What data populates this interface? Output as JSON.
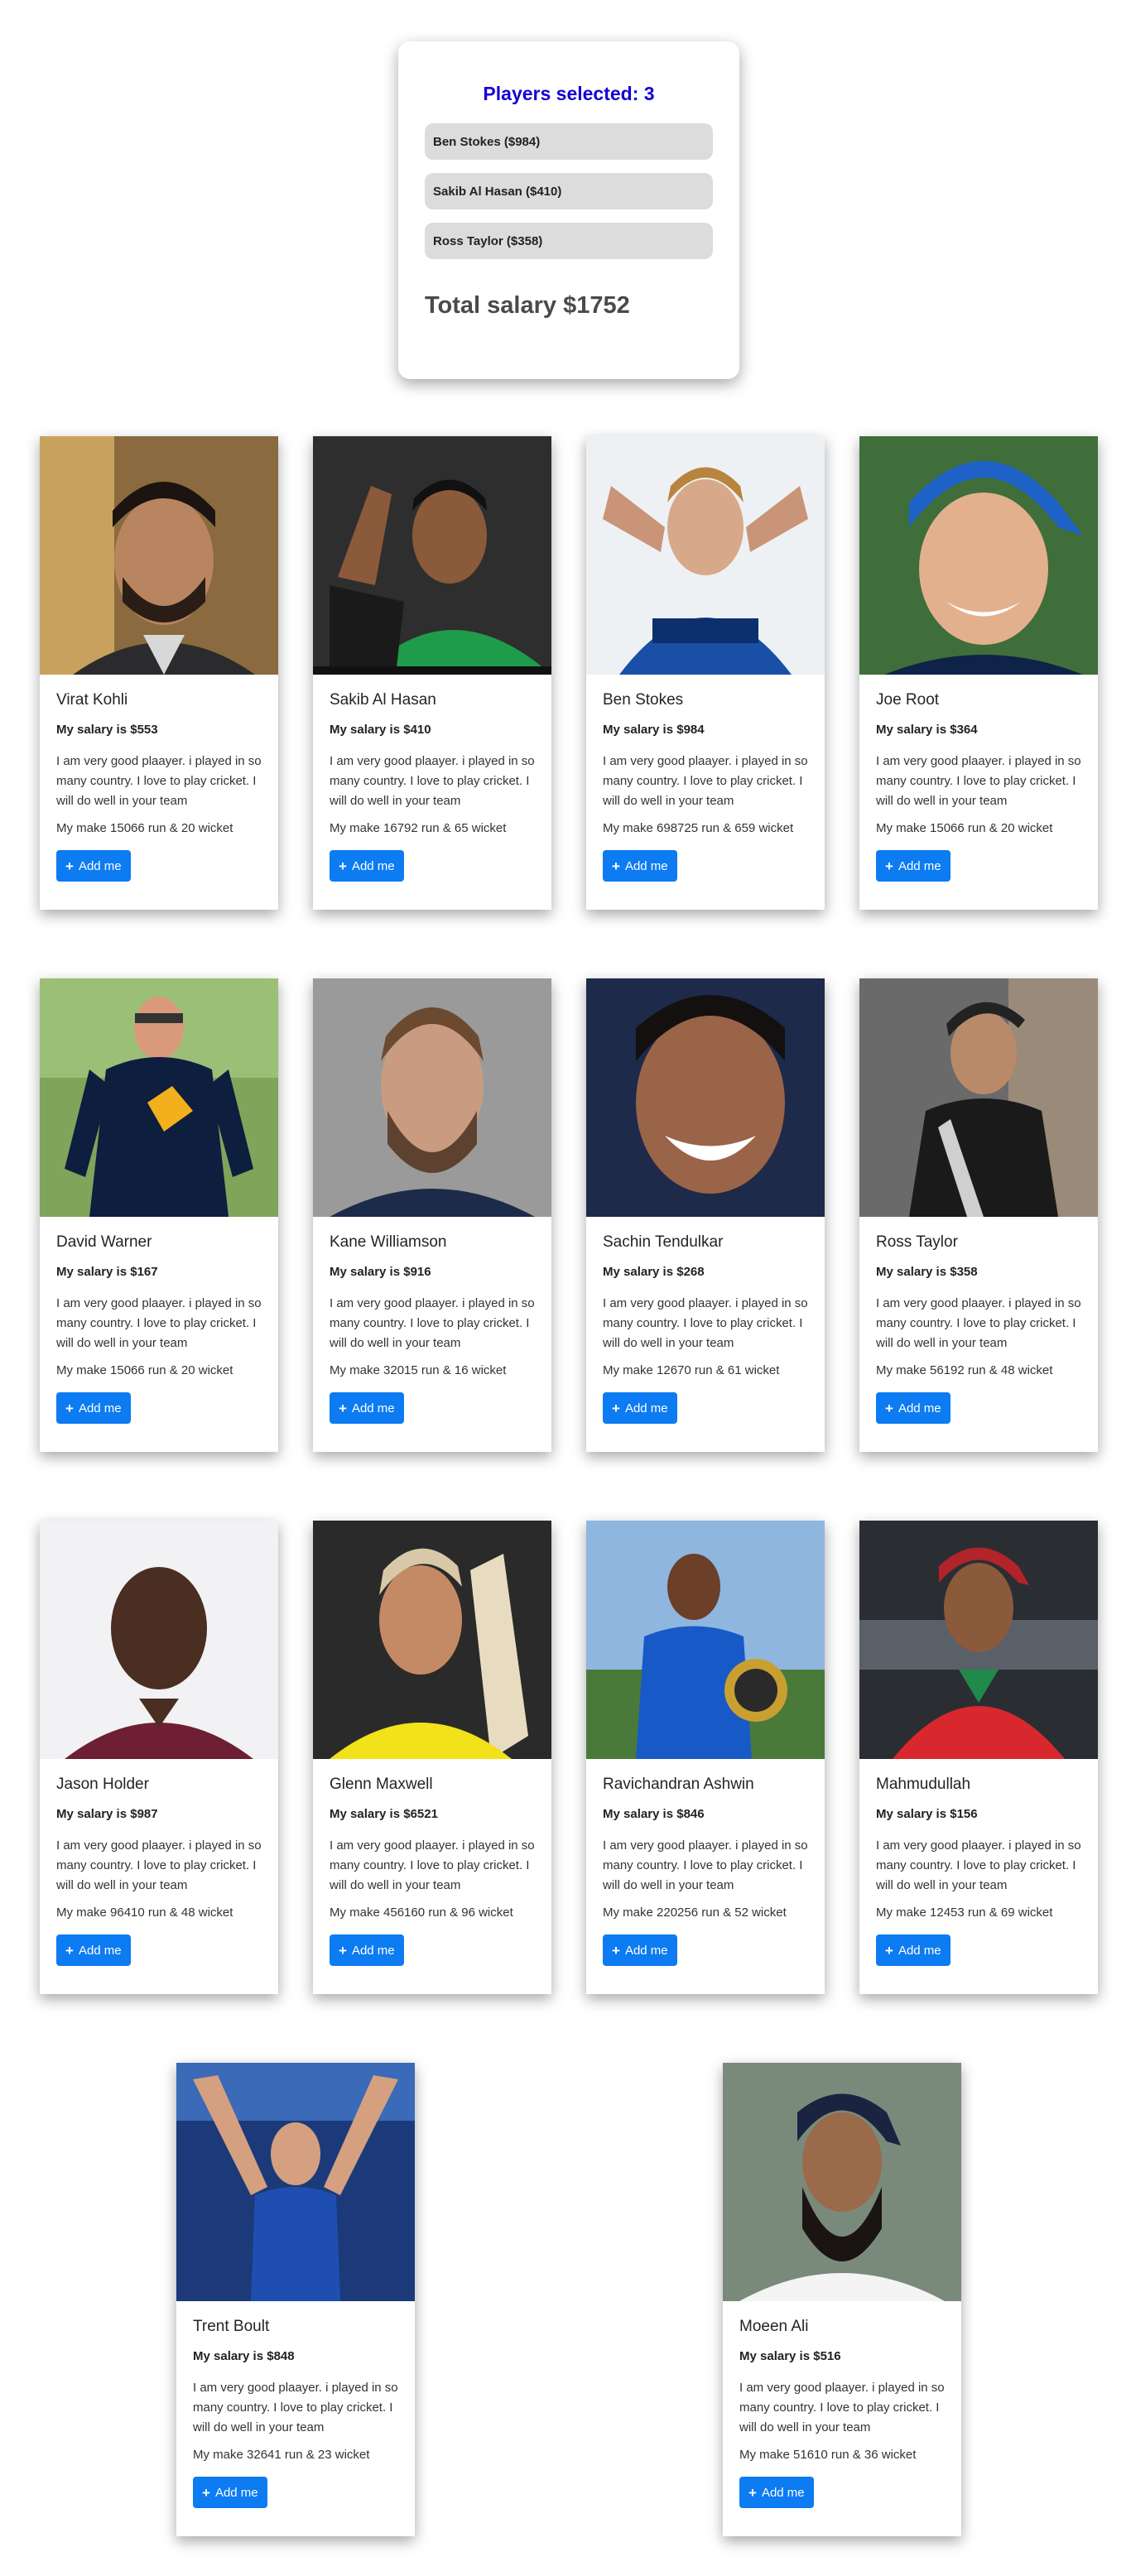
{
  "summary": {
    "title": "Players selected: 3",
    "selected": [
      {
        "label": "Ben Stokes ($984)"
      },
      {
        "label": "Sakib Al Hasan ($410)"
      },
      {
        "label": "Ross Taylor ($358)"
      }
    ],
    "total": "Total salary $1752"
  },
  "add_label": "Add me",
  "players": [
    {
      "name": "Virat Kohli",
      "salary": "My salary is $553",
      "about": "I am very good plaayer. i played in so many country. I love to play cricket. I will do well in your team",
      "stats": "My make 15066 run & 20 wicket"
    },
    {
      "name": "Sakib Al Hasan",
      "salary": "My salary is $410",
      "about": "I am very good plaayer. i played in so many country. I love to play cricket. I will do well in your team",
      "stats": "My make 16792 run & 65 wicket"
    },
    {
      "name": "Ben Stokes",
      "salary": "My salary is $984",
      "about": "I am very good plaayer. i played in so many country. I love to play cricket. I will do well in your team",
      "stats": "My make 698725 run & 659 wicket"
    },
    {
      "name": "Joe Root",
      "salary": "My salary is $364",
      "about": "I am very good plaayer. i played in so many country. I love to play cricket. I will do well in your team",
      "stats": "My make 15066 run & 20 wicket"
    },
    {
      "name": "David Warner",
      "salary": "My salary is $167",
      "about": "I am very good plaayer. i played in so many country. I love to play cricket. I will do well in your team",
      "stats": "My make 15066 run & 20 wicket"
    },
    {
      "name": "Kane Williamson",
      "salary": "My salary is $916",
      "about": "I am very good plaayer. i played in so many country. I love to play cricket. I will do well in your team",
      "stats": "My make 32015 run & 16 wicket"
    },
    {
      "name": "Sachin Tendulkar",
      "salary": "My salary is $268",
      "about": "I am very good plaayer. i played in so many country. I love to play cricket. I will do well in your team",
      "stats": "My make 12670 run & 61 wicket"
    },
    {
      "name": "Ross Taylor",
      "salary": "My salary is $358",
      "about": "I am very good plaayer. i played in so many country. I love to play cricket. I will do well in your team",
      "stats": "My make 56192 run & 48 wicket"
    },
    {
      "name": "Jason Holder",
      "salary": "My salary is $987",
      "about": "I am very good plaayer. i played in so many country. I love to play cricket. I will do well in your team",
      "stats": "My make 96410 run & 48 wicket"
    },
    {
      "name": "Glenn Maxwell",
      "salary": "My salary is $6521",
      "about": "I am very good plaayer. i played in so many country. I love to play cricket. I will do well in your team",
      "stats": "My make 456160 run & 96 wicket"
    },
    {
      "name": "Ravichandran Ashwin",
      "salary": "My salary is $846",
      "about": "I am very good plaayer. i played in so many country. I love to play cricket. I will do well in your team",
      "stats": "My make 220256 run & 52 wicket"
    },
    {
      "name": "Mahmudullah",
      "salary": "My salary is $156",
      "about": "I am very good plaayer. i played in so many country. I love to play cricket. I will do well in your team",
      "stats": "My make 12453 run & 69 wicket"
    },
    {
      "name": "Trent Boult",
      "salary": "My salary is $848",
      "about": "I am very good plaayer. i played in so many country. I love to play cricket. I will do well in your team",
      "stats": "My make 32641 run & 23 wicket"
    },
    {
      "name": "Moeen Ali",
      "salary": "My salary is $516",
      "about": "I am very good plaayer. i played in so many country. I love to play cricket. I will do well in your team",
      "stats": "My make 51610 run & 36 wicket"
    }
  ],
  "colors": {
    "accent": "#0d7bf2",
    "title": "#1400d6",
    "selected_bg": "#dcdcdc"
  }
}
